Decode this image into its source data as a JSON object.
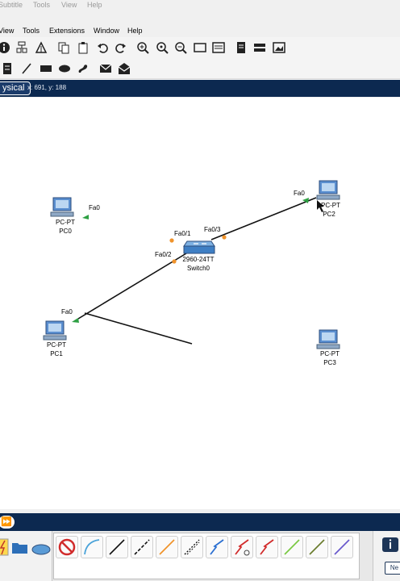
{
  "menu_top": [
    "Subtitle",
    "Tools",
    "View",
    "Help"
  ],
  "menu_main": [
    "View",
    "Tools",
    "Extensions",
    "Window",
    "Help"
  ],
  "mode": {
    "label": "ysical",
    "coords": "x: 691, y: 188"
  },
  "devices": [
    {
      "type": "PC-PT",
      "name": "PC0"
    },
    {
      "type": "PC-PT",
      "name": "PC1"
    },
    {
      "type": "PC-PT",
      "name": "PC2"
    },
    {
      "type": "PC-PT",
      "name": "PC3"
    },
    {
      "type": "2960-24TT",
      "name": "Switch0"
    }
  ],
  "ports": [
    "Fa0",
    "Fa0/1",
    "Fa0/3",
    "Fa0",
    "Fa0/2",
    "Fa0"
  ],
  "panel": {
    "ne_label": "Ne"
  },
  "colors": {
    "link": "#111111",
    "link_up": "#2ea043",
    "link_pending": "#f0932b",
    "dark_bar": "#0c2950"
  }
}
